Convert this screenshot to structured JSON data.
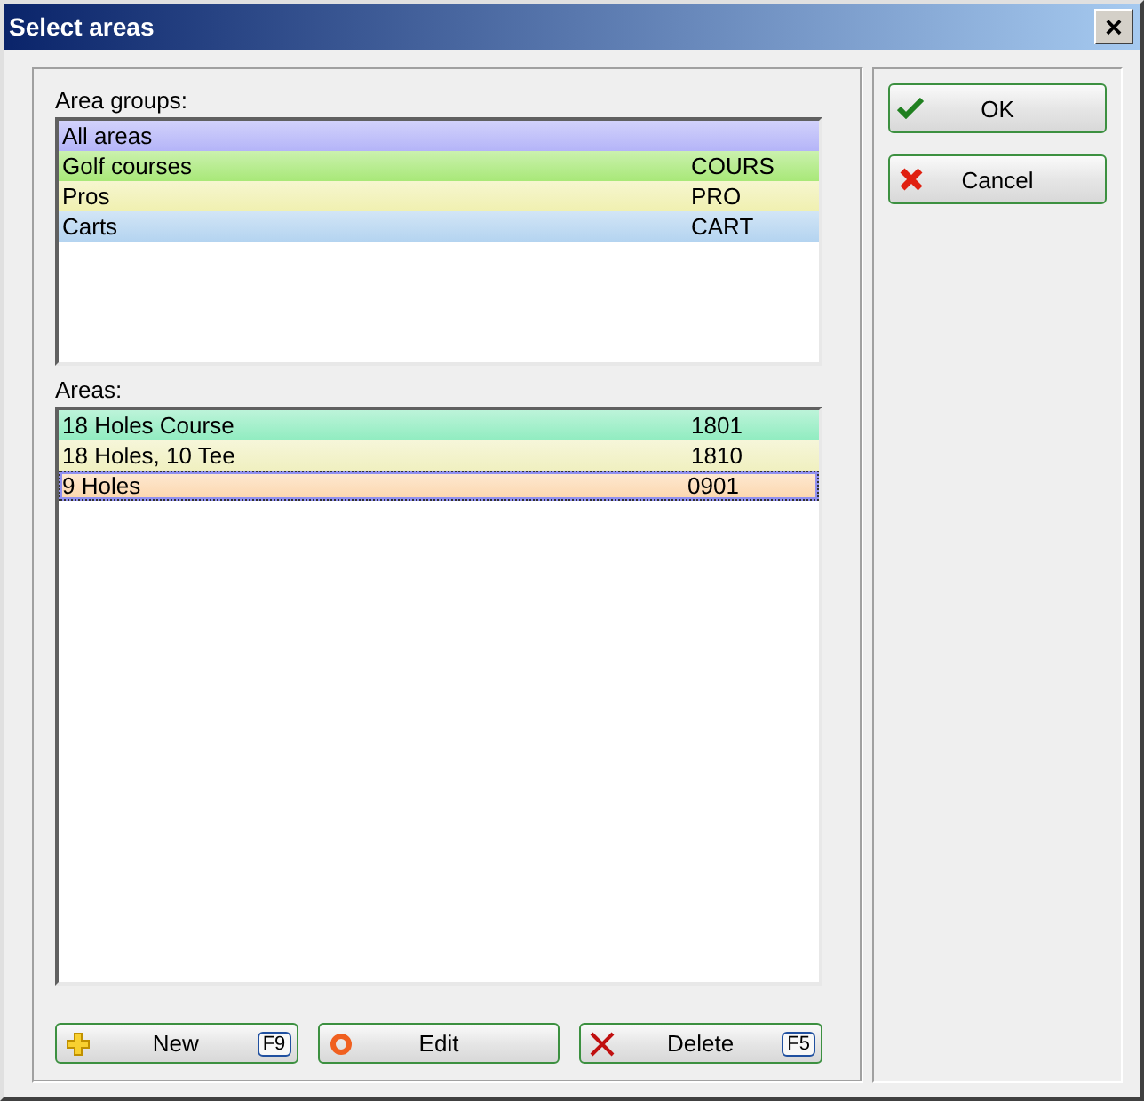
{
  "window": {
    "title": "Select areas",
    "close": "×"
  },
  "area_groups": {
    "label": "Area groups:",
    "rows": [
      {
        "name": "All areas",
        "code": "",
        "color": "#b4b4f8",
        "selected": false
      },
      {
        "name": "Golf courses",
        "code": "COURS",
        "color": "#a8e878",
        "selected": false
      },
      {
        "name": "Pros",
        "code": "PRO",
        "color": "#f0f0b0",
        "selected": false
      },
      {
        "name": "Carts",
        "code": "CART",
        "color": "#b4d4f0",
        "selected": false
      }
    ]
  },
  "areas": {
    "label": "Areas:",
    "rows": [
      {
        "name": "18 Holes Course",
        "code": "1801",
        "color": "#90ecc0",
        "selected": false
      },
      {
        "name": "18 Holes, 10 Tee",
        "code": "1810",
        "color": "#f0f0c0",
        "selected": false
      },
      {
        "name": "9 Holes",
        "code": "0901",
        "color": "#fcd8b0",
        "selected": true
      }
    ]
  },
  "bottom_buttons": [
    {
      "kind": "new",
      "label": "New",
      "key": "F9"
    },
    {
      "kind": "edit",
      "label": "Edit"
    },
    {
      "kind": "delete",
      "label": "Delete",
      "key": "F5"
    }
  ],
  "side_buttons": [
    {
      "kind": "ok",
      "label": "OK"
    },
    {
      "kind": "cancel",
      "label": "Cancel"
    }
  ]
}
